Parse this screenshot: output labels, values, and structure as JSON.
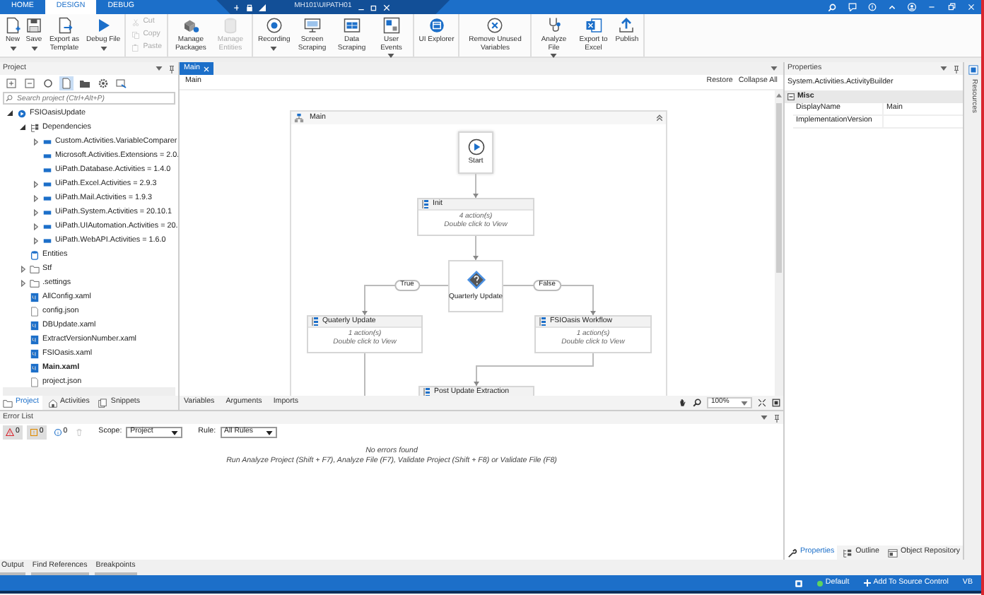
{
  "title_bar": {
    "tabs": [
      {
        "label": "HOME",
        "selected": false
      },
      {
        "label": "DESIGN",
        "selected": true
      },
      {
        "label": "DEBUG",
        "selected": false
      }
    ],
    "remote_session": "MH101\\UIPATH01"
  },
  "ribbon": {
    "groups": [
      {
        "kind": "large",
        "items": [
          {
            "label": "New",
            "dropdown": true,
            "disabled": false
          },
          {
            "label": "Save",
            "dropdown": true,
            "disabled": false
          },
          {
            "label": "Export as Template",
            "dropdown": false,
            "disabled": false
          },
          {
            "label": "Debug File",
            "dropdown": true,
            "disabled": false
          }
        ]
      },
      {
        "kind": "stack",
        "items": [
          {
            "label": "Cut",
            "dropdown": false,
            "disabled": true
          },
          {
            "label": "Copy",
            "dropdown": false,
            "disabled": true
          },
          {
            "label": "Paste",
            "dropdown": false,
            "disabled": true
          }
        ]
      },
      {
        "kind": "large",
        "items": [
          {
            "label": "Manage Packages",
            "dropdown": false,
            "disabled": false
          },
          {
            "label": "Manage Entities",
            "dropdown": false,
            "disabled": true
          }
        ]
      },
      {
        "kind": "large",
        "items": [
          {
            "label": "Recording",
            "dropdown": true,
            "disabled": false
          },
          {
            "label": "Screen Scraping",
            "dropdown": false,
            "disabled": false
          },
          {
            "label": "Data Scraping",
            "dropdown": false,
            "disabled": false
          },
          {
            "label": "User Events",
            "dropdown": true,
            "disabled": false
          }
        ]
      },
      {
        "kind": "large",
        "items": [
          {
            "label": "UI Explorer",
            "dropdown": false,
            "disabled": false
          }
        ]
      },
      {
        "kind": "large",
        "items": [
          {
            "label": "Remove Unused Variables",
            "dropdown": false,
            "disabled": false
          }
        ]
      },
      {
        "kind": "large",
        "items": [
          {
            "label": "Analyze File",
            "dropdown": true,
            "disabled": false
          },
          {
            "label": "Export to Excel",
            "dropdown": false,
            "disabled": false
          },
          {
            "label": "Publish",
            "dropdown": false,
            "disabled": false
          }
        ]
      }
    ]
  },
  "project_panel": {
    "title": "Project",
    "search": {
      "placeholder": "Search project (Ctrl+Alt+P)"
    },
    "tree": [
      {
        "label": "FSIOasisUpdate",
        "kind": "project",
        "expanded": true,
        "children": [
          {
            "label": "Dependencies",
            "kind": "dependencies",
            "expanded": true,
            "children": [
              {
                "label": "Custom.Activities.VariableComparer",
                "kind": "package",
                "expanded": false
              },
              {
                "label": "Microsoft.Activities.Extensions = 2.0.",
                "kind": "package"
              },
              {
                "label": "UiPath.Database.Activities = 1.4.0",
                "kind": "package"
              },
              {
                "label": "UiPath.Excel.Activities = 2.9.3",
                "kind": "package",
                "expanded": false
              },
              {
                "label": "UiPath.Mail.Activities = 1.9.3",
                "kind": "package",
                "expanded": false
              },
              {
                "label": "UiPath.System.Activities = 20.10.1",
                "kind": "package",
                "expanded": false
              },
              {
                "label": "UiPath.UIAutomation.Activities = 20.",
                "kind": "package",
                "expanded": false
              },
              {
                "label": "UiPath.WebAPI.Activities = 1.6.0",
                "kind": "package",
                "expanded": false
              }
            ]
          },
          {
            "label": "Entities",
            "kind": "entities"
          },
          {
            "label": "Stf",
            "kind": "folder",
            "expanded": false
          },
          {
            "label": ".settings",
            "kind": "folder",
            "expanded": false
          },
          {
            "label": "AllConfig.xaml",
            "kind": "xaml",
            "open": false
          },
          {
            "label": "config.json",
            "kind": "json",
            "open": false
          },
          {
            "label": "DBUpdate.xaml",
            "kind": "xaml",
            "open": false
          },
          {
            "label": "ExtractVersionNumber.xaml",
            "kind": "xaml",
            "open": false
          },
          {
            "label": "FSIOasis.xaml",
            "kind": "xaml",
            "open": false
          },
          {
            "label": "Main.xaml",
            "kind": "xaml",
            "open": true
          },
          {
            "label": "project.json",
            "kind": "json",
            "open": false
          }
        ]
      }
    ],
    "tabs": [
      {
        "label": "Project",
        "selected": true
      },
      {
        "label": "Activities",
        "selected": false
      },
      {
        "label": "Snippets",
        "selected": false
      }
    ]
  },
  "designer": {
    "tabs": [
      {
        "label": "Main",
        "selected": true
      }
    ],
    "breadcrumb": "Main",
    "actions": [
      "Restore",
      "Collapse All"
    ],
    "flowchart": {
      "title": "Main",
      "nodes": [
        {
          "kind": "start",
          "label": "Start"
        },
        {
          "kind": "sequence",
          "title": "Init",
          "count": "4 action(s)",
          "hint": "Double click to View"
        },
        {
          "kind": "decision",
          "label": "Quarterly Update",
          "true_label": "True",
          "false_label": "False"
        },
        {
          "kind": "sequence",
          "title": "Quaterly Update",
          "count": "1 action(s)",
          "hint": "Double click to View"
        },
        {
          "kind": "sequence",
          "title": "FSIOasis Workflow",
          "count": "1 action(s)",
          "hint": "Double click to View"
        },
        {
          "kind": "sequence",
          "title": "Post Update Extraction"
        }
      ]
    },
    "bottom_tabs": [
      "Variables",
      "Arguments",
      "Imports"
    ],
    "zoom": "100%"
  },
  "error_list": {
    "title": "Error List",
    "filters": [
      {
        "kind": "error",
        "count": "0",
        "selected": true
      },
      {
        "kind": "warning",
        "count": "0",
        "selected": true
      },
      {
        "kind": "info",
        "count": "0",
        "selected": false
      }
    ],
    "scope": {
      "label": "Scope:",
      "value": "Project"
    },
    "rule": {
      "label": "Rule:",
      "value": "All Rules"
    },
    "messages": [
      "No errors found",
      "Run Analyze Project (Shift + F7), Analyze File (F7), Validate Project (Shift + F8) or Validate File (F8)"
    ]
  },
  "properties": {
    "title": "Properties",
    "type_name": "System.Activities.ActivityBuilder",
    "category": {
      "label": "Misc",
      "expanded": true
    },
    "rows": [
      {
        "name": "DisplayName",
        "value": "Main"
      },
      {
        "name": "ImplementationVersion"
      }
    ],
    "tabs": [
      {
        "label": "Properties",
        "selected": true
      },
      {
        "label": "Outline",
        "selected": false
      },
      {
        "label": "Object Repository",
        "selected": false
      }
    ]
  },
  "side_strip": {
    "label": "Resources"
  },
  "bottom_tabs": [
    "Output",
    "Find References",
    "Breakpoints"
  ],
  "status_bar": {
    "profile": "Default",
    "source_control": "Add To Source Control",
    "language": "VB"
  }
}
